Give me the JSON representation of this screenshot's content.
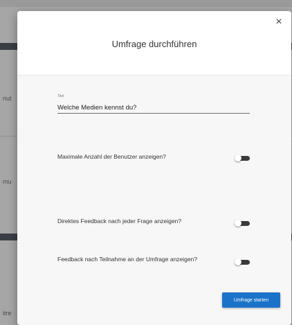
{
  "background": {
    "fragments": [
      "nut",
      "mu",
      "itre"
    ]
  },
  "dialog": {
    "title": "Umfrage durchführen",
    "close_glyph": "×",
    "title_field": {
      "label": "Titel",
      "value": "Welche Medien kennst du?"
    },
    "toggles": [
      {
        "label": "Maximale Anzahl der Benutzer anzeigen?",
        "checked": false
      },
      {
        "label": "Direktes Feedback nach jeder Frage anzeigen?",
        "checked": false
      },
      {
        "label": "Feedback nach Teilnahme an der Umfrage anzeigen?",
        "checked": false
      }
    ],
    "start_button": "Umfrage starten"
  },
  "colors": {
    "accent": "#1a73c9",
    "toggle_track": "#3a3a3a"
  }
}
